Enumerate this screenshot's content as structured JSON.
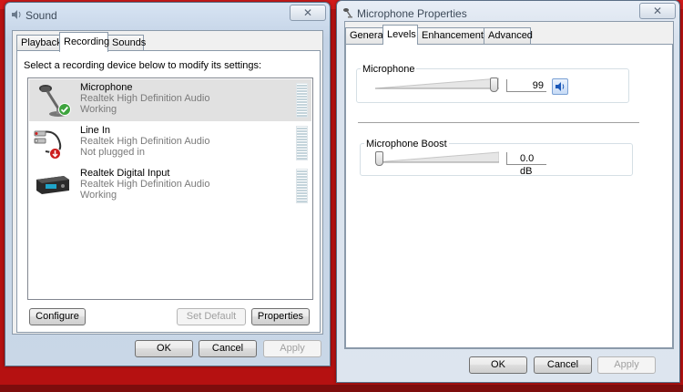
{
  "sound_window": {
    "title": "Sound",
    "close_glyph": "✕",
    "tabs": [
      {
        "label": "Playback",
        "active": false
      },
      {
        "label": "Recording",
        "active": true
      },
      {
        "label": "Sounds",
        "active": false
      }
    ],
    "instruction": "Select a recording device below to modify its settings:",
    "devices": [
      {
        "name": "Microphone",
        "driver": "Realtek High Definition Audio",
        "status": "Working",
        "icon": "microphone-icon",
        "badge": "default-check-icon",
        "selected": true
      },
      {
        "name": "Line In",
        "driver": "Realtek High Definition Audio",
        "status": "Not plugged in",
        "icon": "line-in-cable-icon",
        "badge": "unplugged-arrow-icon",
        "selected": false
      },
      {
        "name": "Realtek Digital Input",
        "driver": "Realtek High Definition Audio",
        "status": "Working",
        "icon": "digital-input-device-icon",
        "badge": null,
        "selected": false
      }
    ],
    "buttons": {
      "configure": "Configure",
      "set_default": "Set Default",
      "properties": "Properties",
      "ok": "OK",
      "cancel": "Cancel",
      "apply": "Apply"
    }
  },
  "mic_properties_window": {
    "title": "Microphone Properties",
    "close_glyph": "✕",
    "tabs": [
      {
        "label": "General",
        "active": false
      },
      {
        "label": "Levels",
        "active": true
      },
      {
        "label": "Enhancements",
        "active": false
      },
      {
        "label": "Advanced",
        "active": false
      }
    ],
    "levels": {
      "microphone_label": "Microphone",
      "microphone_value": "99",
      "microphone_level_fraction": 0.99,
      "mute_icon": "speaker-icon",
      "boost_label": "Microphone Boost",
      "boost_value": "0.0 dB",
      "boost_level_fraction": 0.0
    },
    "buttons": {
      "ok": "OK",
      "cancel": "Cancel",
      "apply": "Apply"
    }
  },
  "colors": {
    "desktop_red": "#b51111",
    "selection_gray": "#e1e1e1",
    "mute_button_blue": "#c7dbf6"
  }
}
